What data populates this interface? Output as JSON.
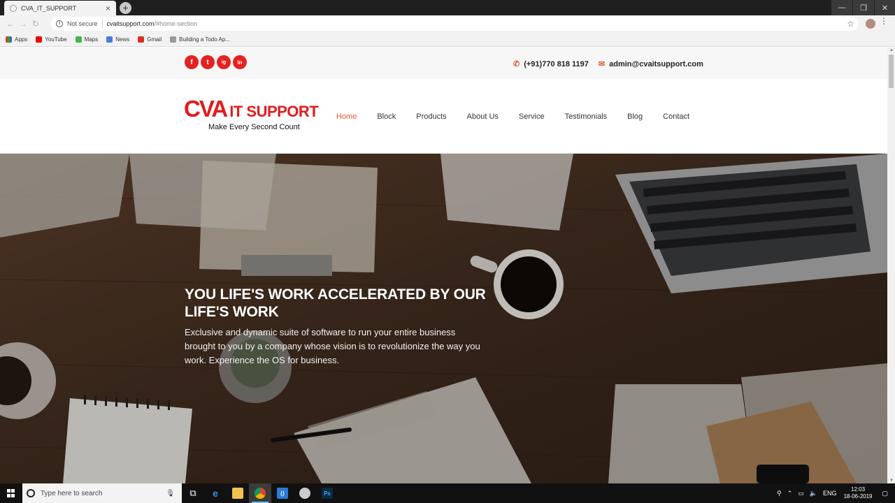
{
  "browser": {
    "tab_title": "CVA_IT_SUPPORT",
    "tab_close": "×",
    "new_tab": "+",
    "security_label": "Not secure",
    "url_host": "cvaitsupport.com",
    "url_rest": "/#home-section",
    "bookmarks": [
      "Apps",
      "YouTube",
      "Maps",
      "News",
      "Gmail",
      "Building a Todo Ap..."
    ]
  },
  "site": {
    "social": [
      "f",
      "t",
      "ig",
      "in"
    ],
    "phone": "(+91)770 818 1197",
    "email": "admin@cvaitsupport.com",
    "logo_main": "CVA",
    "logo_sub": "IT SUPPORT",
    "tagline": "Make Every Second Count",
    "nav": [
      "Home",
      "Block",
      "Products",
      "About Us",
      "Service",
      "Testimonials",
      "Blog",
      "Contact"
    ],
    "active_nav": "Home",
    "hero_title": "YOU LIFE'S WORK ACCELERATED BY OUR LIFE'S WORK",
    "hero_text": "Exclusive and dynamic suite of software to run your entire business brought to you by a company whose vision is to revolutionize the way you work. Experience the OS for business."
  },
  "taskbar": {
    "search_placeholder": "Type here to search",
    "language": "ENG",
    "time": "12:03",
    "date": "18-06-2019"
  },
  "colors": {
    "brand_red": "#e21c1c",
    "accent_orange": "#e55a2b"
  }
}
